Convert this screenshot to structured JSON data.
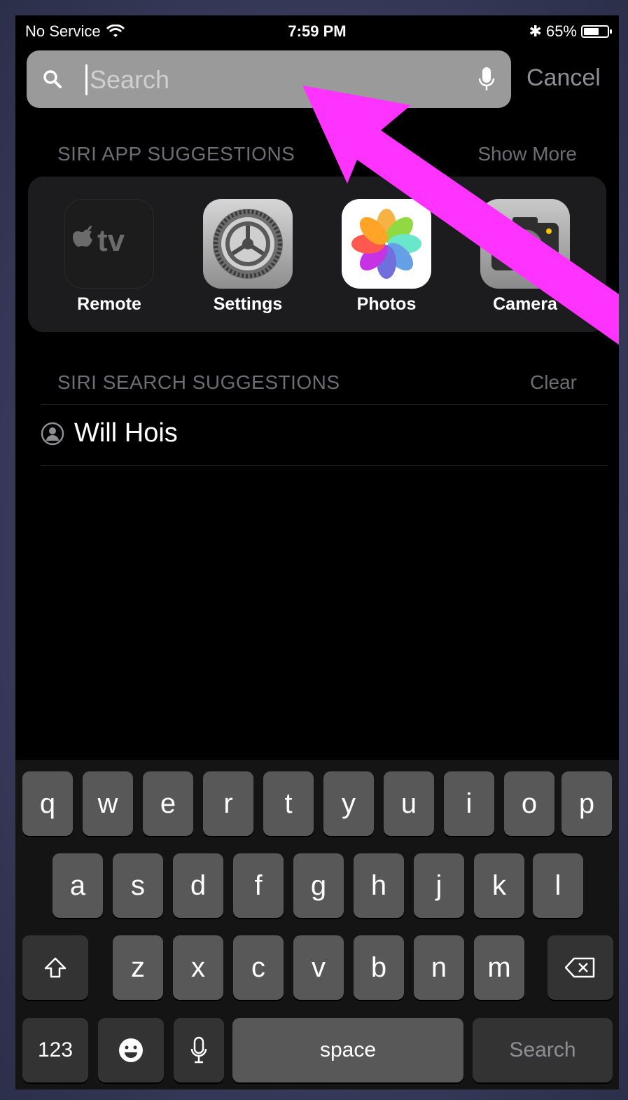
{
  "status_bar": {
    "carrier": "No Service",
    "time": "7:59 PM",
    "battery": "65%",
    "battery_level": 0.65
  },
  "search": {
    "placeholder": "Search",
    "cancel_label": "Cancel"
  },
  "app_suggestions": {
    "heading": "SIRI APP SUGGESTIONS",
    "action": "Show More",
    "apps": [
      {
        "label": "Remote",
        "icon": "apple-tv-remote-icon"
      },
      {
        "label": "Settings",
        "icon": "settings-gear-icon"
      },
      {
        "label": "Photos",
        "icon": "photos-flower-icon"
      },
      {
        "label": "Camera",
        "icon": "camera-icon"
      }
    ]
  },
  "search_suggestions": {
    "heading": "SIRI SEARCH SUGGESTIONS",
    "action": "Clear",
    "items": [
      {
        "label": "Will Hois",
        "icon": "person-icon"
      }
    ]
  },
  "keyboard": {
    "row1": [
      "q",
      "w",
      "e",
      "r",
      "t",
      "y",
      "u",
      "i",
      "o",
      "p"
    ],
    "row2": [
      "a",
      "s",
      "d",
      "f",
      "g",
      "h",
      "j",
      "k",
      "l"
    ],
    "row3": [
      "z",
      "x",
      "c",
      "v",
      "b",
      "n",
      "m"
    ],
    "numbers_label": "123",
    "space_label": "space",
    "return_label": "Search"
  },
  "colors": {
    "annotation_arrow": "#ff33ff",
    "search_field": "#9a9a9a",
    "key": "#585858"
  }
}
